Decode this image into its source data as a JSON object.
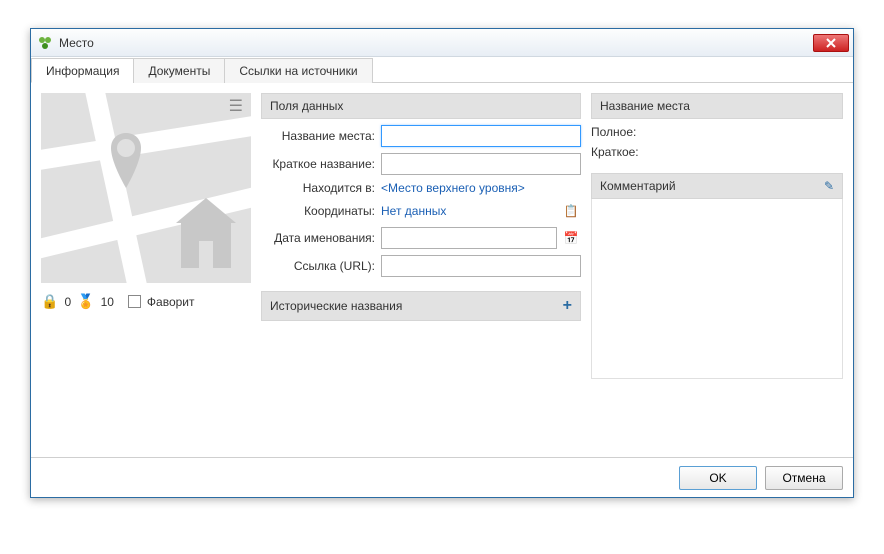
{
  "window": {
    "title": "Место"
  },
  "tabs": [
    {
      "label": "Информация",
      "active": true
    },
    {
      "label": "Документы",
      "active": false
    },
    {
      "label": "Ссылки на источники",
      "active": false
    }
  ],
  "left": {
    "lock_count": "0",
    "ribbon_count": "10",
    "favorite_label": "Фаворит"
  },
  "mid": {
    "fields_header": "Поля данных",
    "name_label": "Название места:",
    "short_label": "Краткое название:",
    "located_label": "Находится в:",
    "located_value": "<Место верхнего уровня>",
    "coords_label": "Координаты:",
    "coords_value": "Нет данных",
    "date_label": "Дата именования:",
    "url_label": "Ссылка (URL):",
    "hist_header": "Исторические названия"
  },
  "right": {
    "name_header": "Название места",
    "full_label": "Полное:",
    "short_label": "Краткое:",
    "comment_header": "Комментарий"
  },
  "footer": {
    "ok": "OK",
    "cancel": "Отмена"
  }
}
